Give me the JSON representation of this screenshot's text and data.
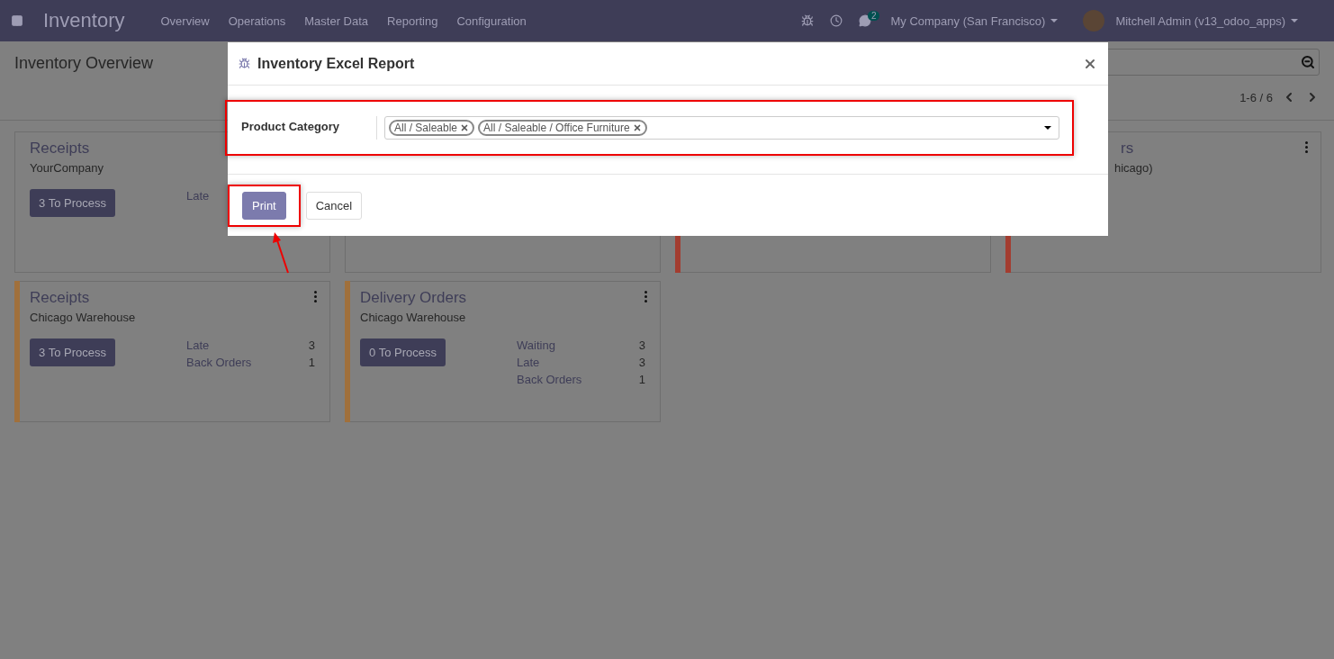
{
  "navbar": {
    "app_title": "Inventory",
    "menu": [
      "Overview",
      "Operations",
      "Master Data",
      "Reporting",
      "Configuration"
    ],
    "message_count": "2",
    "company": "My Company (San Francisco)",
    "user": "Mitchell Admin (v13_odoo_apps)"
  },
  "control_panel": {
    "title": "Inventory Overview",
    "pager": "1-6 / 6"
  },
  "cards": [
    {
      "kind": "full",
      "title": "Receipts",
      "subtitle": "YourCompany",
      "button": "3 To Process",
      "stats": [
        {
          "label": "Late"
        }
      ]
    },
    {
      "kind": "covered"
    },
    {
      "kind": "covered",
      "color": "#a33d30"
    },
    {
      "kind": "covered",
      "title": "rs",
      "subtitle": "hicago)",
      "color": "#a33d30"
    },
    {
      "kind": "full",
      "title": "Receipts",
      "subtitle": "Chicago Warehouse",
      "button": "3 To Process",
      "color": "#a0703c",
      "stats": [
        {
          "label": "Late",
          "value": "3"
        },
        {
          "label": "Back Orders",
          "value": "1"
        }
      ]
    },
    {
      "kind": "full",
      "title": "Delivery Orders",
      "subtitle": "Chicago Warehouse",
      "button": "0 To Process",
      "color": "#a0703c",
      "stats": [
        {
          "label": "Waiting",
          "value": "3"
        },
        {
          "label": "Late",
          "value": "3"
        },
        {
          "label": "Back Orders",
          "value": "1"
        }
      ]
    }
  ],
  "dialog": {
    "title": "Inventory Excel Report",
    "field_label": "Product Category",
    "tags": [
      "All / Saleable",
      "All / Saleable / Office Furniture"
    ],
    "buttons": [
      {
        "label": "Print",
        "kind": "primary"
      },
      {
        "label": "Cancel",
        "kind": "secondary"
      }
    ]
  },
  "annotations": {
    "field_frame": true,
    "print_frame": true,
    "arrow": true
  }
}
